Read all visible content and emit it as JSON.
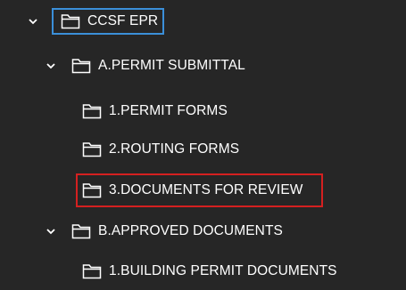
{
  "tree": {
    "root": {
      "label": "CCSF EPR",
      "expanded": true,
      "selected": true
    },
    "permit_submittal": {
      "label": "A.PERMIT SUBMITTAL",
      "expanded": true
    },
    "permit_forms": {
      "label": "1.PERMIT FORMS"
    },
    "routing_forms": {
      "label": "2.ROUTING FORMS"
    },
    "documents_for_review": {
      "label": "3.DOCUMENTS FOR REVIEW",
      "highlighted": true
    },
    "approved_documents": {
      "label": "B.APPROVED DOCUMENTS",
      "expanded": true
    },
    "building_permit_documents": {
      "label": "1.BUILDING PERMIT DOCUMENTS"
    }
  },
  "icons": {
    "expand": "chevron-down-icon",
    "folder": "folder-icon"
  },
  "colors": {
    "background": "#262626",
    "text": "#ffffff",
    "selection_border": "#3b8fd9",
    "highlight_border": "#d42020"
  }
}
